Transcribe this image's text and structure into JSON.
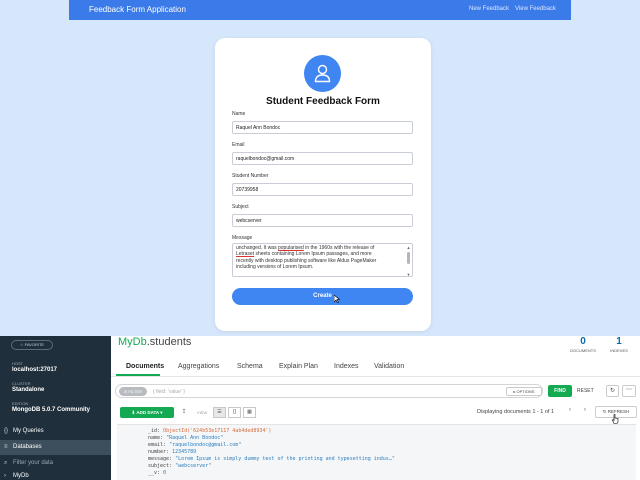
{
  "navbar": {
    "brand": "Feedback Form Application",
    "links": [
      "New Feedback",
      "View Feedback"
    ],
    "color": "#3b7be9"
  },
  "form": {
    "title": "Student Feedback Form",
    "avatar_icon": "user-icon",
    "fields": [
      {
        "label": "Name",
        "value": "Raquel Ann Bondoc"
      },
      {
        "label": "Email",
        "value": "raquelbondoc@gmail.com"
      },
      {
        "label": "Student Number",
        "value": "20739958"
      },
      {
        "label": "Subject",
        "value": "webcserver"
      }
    ],
    "message_label": "Message",
    "message_lines": [
      {
        "pre": "unchanged. It was ",
        "u": "popularised",
        "post": " in the 1960s with the release of"
      },
      {
        "pre": "",
        "u": "Letraset",
        "post": " sheets containing Lorem Ipsum passages, and more"
      },
      {
        "pre": "recently with desktop publishing software like Aldus PageMaker",
        "u": "",
        "post": ""
      },
      {
        "pre": "including versions of Lorem Ipsum.",
        "u": "",
        "post": ""
      }
    ],
    "submit_label": "Create"
  },
  "compass": {
    "sidebar": {
      "favorite_label": "☆ FAVORITE",
      "host_caption": "HOST",
      "host": "localhost:27017",
      "cluster_caption": "CLUSTER",
      "cluster": "Standalone",
      "edition_caption": "EDITION",
      "edition": "MongoDB 5.0.7 Community",
      "my_queries": "My Queries",
      "databases": "Databases",
      "filter_placeholder": "Filter your data",
      "db_item": "MyDb"
    },
    "collection": {
      "db": "MyDb",
      "sep": ".",
      "name": "students"
    },
    "stats": {
      "documents": "0",
      "documents_label": "DOCUMENTS",
      "indexes": "1",
      "indexes_label": "INDEXES"
    },
    "tabs": [
      "Documents",
      "Aggregations",
      "Schema",
      "Explain Plan",
      "Indexes",
      "Validation"
    ],
    "query": {
      "filter_tag": "⊘ FILTER",
      "placeholder": "{ field: 'value' }",
      "options_label": "▸ OPTIONS",
      "find_label": "FIND",
      "reset_label": "RESET",
      "history_icon": "↻",
      "more_icon": "⋯"
    },
    "toolbar": {
      "add_data_label": "⬇ ADD DATA ▾",
      "view_label": "VIEW",
      "display_text": "Displaying documents 1 - 1 of 1",
      "prev": "‹",
      "next": "›",
      "refresh_label": "↻ REFRESH"
    },
    "document": [
      {
        "key": "_id: ",
        "val": "ObjectId('624b53e17117 4ab4ded8934')",
        "cls": "o"
      },
      {
        "key": "name: ",
        "val": "\"Raquel Ann Bondoc\"",
        "cls": "s"
      },
      {
        "key": "email: ",
        "val": "\"raquelbondoc@gmail.com\"",
        "cls": "s"
      },
      {
        "key": "number: ",
        "val": "12345789",
        "cls": "s"
      },
      {
        "key": "message: ",
        "val": "\"Lorem Ipsum is simply dummy text of the printing and typesetting indus…\"",
        "cls": "s"
      },
      {
        "key": "subject: ",
        "val": "\"webcserver\"",
        "cls": "s"
      },
      {
        "key": "__v: ",
        "val": "0",
        "cls": "s"
      }
    ],
    "accent": "#13aa52"
  }
}
